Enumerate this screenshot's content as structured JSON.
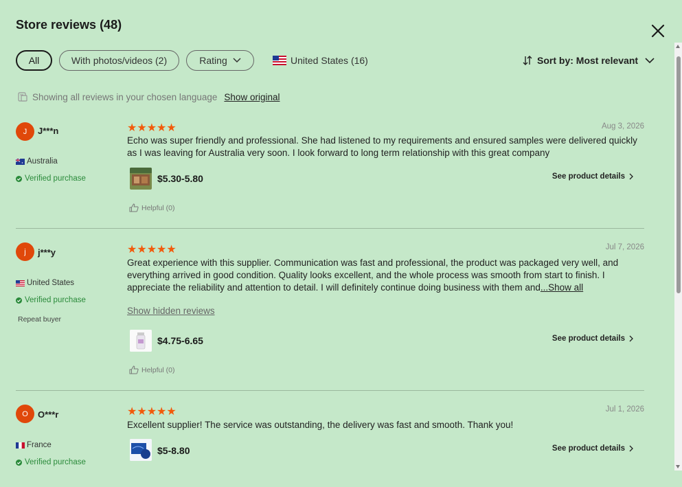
{
  "header": {
    "title": "Store reviews (48)"
  },
  "filters": {
    "all": "All",
    "photos": "With photos/videos (2)",
    "rating": "Rating",
    "country": "United States (16)",
    "sort_prefix": "Sort by: ",
    "sort_value": "Most relevant"
  },
  "language_notice": {
    "text": "Showing all reviews in your chosen language",
    "link": "Show original"
  },
  "colors": {
    "background": "#c5e8c9",
    "star": "#f25a0b",
    "avatar": "#e0480a",
    "verified": "#2a8a3a"
  },
  "reviews": [
    {
      "initial": "J",
      "name": "J***n",
      "country": "Australia",
      "verified": "Verified purchase",
      "stars": "★★★★★",
      "date": "Aug 3, 2026",
      "text": "Echo was super friendly and professional. She had listened to my requirements and ensured samples were delivered quickly as I was leaving for Australia very soon. I look forward to long term relationship with this great company",
      "price": "$5.30-5.80",
      "details": "See product details",
      "helpful": "Helpful (0)"
    },
    {
      "initial": "j",
      "name": "j***y",
      "country": "United States",
      "verified": "Verified purchase",
      "repeat": "Repeat buyer",
      "stars": "★★★★★",
      "date": "Jul 7, 2026",
      "text": "Great experience with this supplier. Communication was fast and professional, the product was packaged very well, and everything arrived in good condition. Quality looks excellent, and the whole process was smooth from start to finish. I appreciate the reliability and attention to detail. I will definitely continue doing business with them and",
      "more": "...Show all",
      "hidden": "Show hidden reviews",
      "price": "$4.75-6.65",
      "details": "See product details",
      "helpful": "Helpful (0)"
    },
    {
      "initial": "O",
      "name": "O***r",
      "country": "France",
      "verified": "Verified purchase",
      "stars": "★★★★★",
      "date": "Jul 1, 2026",
      "text": "Excellent supplier! The service was outstanding, the delivery was fast and smooth. Thank you!",
      "price": "$5-8.80",
      "details": "See product details"
    }
  ]
}
